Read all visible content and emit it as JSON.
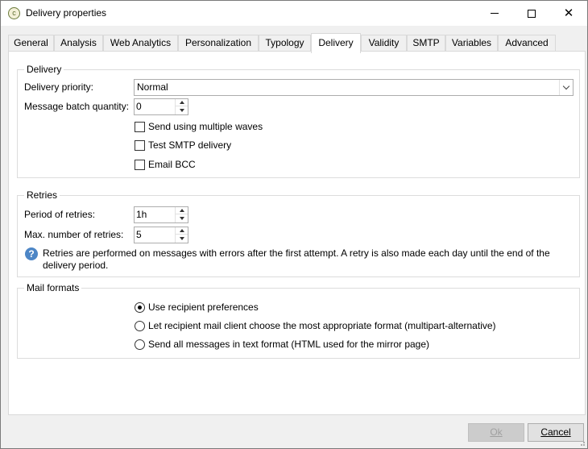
{
  "window": {
    "title": "Delivery properties",
    "app_icon": "adobe-campaign-icon"
  },
  "tabs": [
    {
      "label": "General"
    },
    {
      "label": "Analysis"
    },
    {
      "label": "Web Analytics"
    },
    {
      "label": "Personalization"
    },
    {
      "label": "Typology"
    },
    {
      "label": "Delivery"
    },
    {
      "label": "Validity"
    },
    {
      "label": "SMTP"
    },
    {
      "label": "Variables"
    },
    {
      "label": "Advanced"
    }
  ],
  "active_tab": "Delivery",
  "delivery": {
    "title": "Delivery",
    "priority_label": "Delivery priority:",
    "priority_value": "Normal",
    "batch_label": "Message batch quantity:",
    "batch_value": "0",
    "multiple_waves": {
      "label": "Send using multiple waves",
      "checked": false
    },
    "test_smtp": {
      "label": "Test SMTP delivery",
      "checked": false
    },
    "email_bcc": {
      "label": "Email BCC",
      "checked": false
    }
  },
  "retries": {
    "title": "Retries",
    "period_label": "Period of retries:",
    "period_value": "1h",
    "max_label": "Max. number of retries:",
    "max_value": "5",
    "info_text": "Retries are performed on messages with errors after the first attempt. A retry is also made each day until the end of the delivery period."
  },
  "mail_formats": {
    "title": "Mail formats",
    "options": [
      {
        "label": "Use recipient preferences",
        "selected": true
      },
      {
        "label": "Let recipient mail client choose the most appropriate format (multipart-alternative)",
        "selected": false
      },
      {
        "label": "Send all messages in text format (HTML used for the mirror page)",
        "selected": false
      }
    ]
  },
  "buttons": {
    "ok": "Ok",
    "cancel": "Cancel"
  }
}
